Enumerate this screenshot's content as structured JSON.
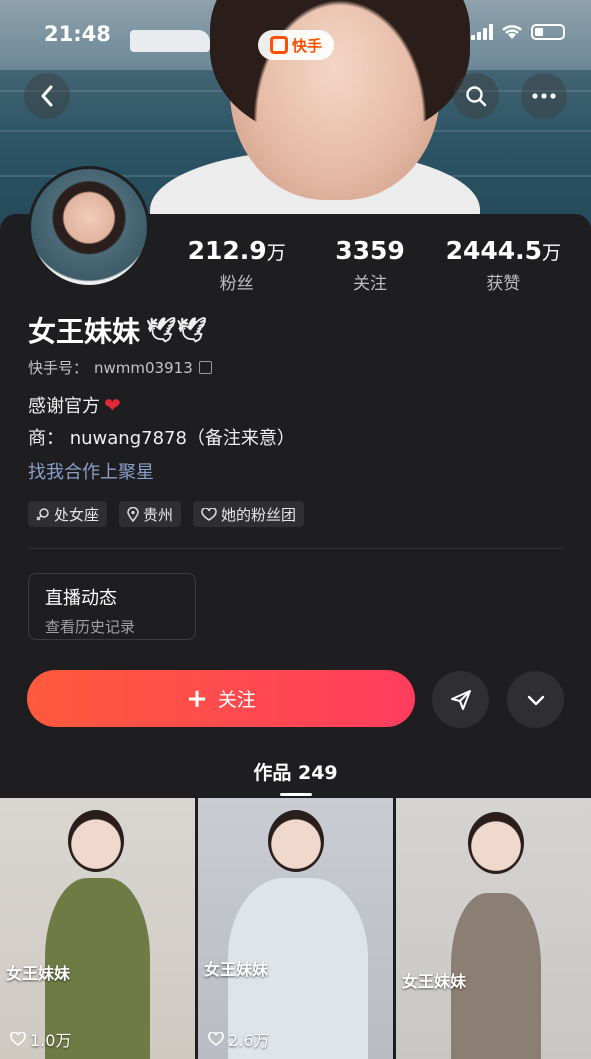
{
  "status_bar": {
    "time": "21:48",
    "app_badge": "快手"
  },
  "profile": {
    "name": "女王妹妹",
    "name_emoji": "🕊🕊",
    "kuaishou_id_label": "快手号：",
    "kuaishou_id": "nwmm03913",
    "bio_line1": "感谢官方",
    "bio_line1_emoji": "❤",
    "bio_line2": "商：  nuwang7878（备注来意）",
    "link": "找我合作上聚星"
  },
  "stats": [
    {
      "value": "212.9",
      "unit": "万",
      "label": "粉丝"
    },
    {
      "value": "3359",
      "unit": "",
      "label": "关注"
    },
    {
      "value": "2444.5",
      "unit": "万",
      "label": "获赞"
    }
  ],
  "tags": [
    {
      "icon": "zodiac-icon",
      "label": "处女座"
    },
    {
      "icon": "location-icon",
      "label": "贵州"
    },
    {
      "icon": "fan-group-icon",
      "label": "她的粉丝团"
    }
  ],
  "live_card": {
    "title": "直播动态",
    "subtitle": "查看历史记录"
  },
  "follow_button": {
    "label": "关注"
  },
  "works_tab": {
    "label": "作品 249"
  },
  "videos": [
    {
      "caption": "女王妹妹",
      "likes": "1.0万"
    },
    {
      "caption": "女王妹妹",
      "likes": "2.6万"
    },
    {
      "caption": "女王妹妹",
      "likes": ""
    }
  ],
  "colors": {
    "accent_start": "#ff5a3c",
    "accent_end": "#ff3d5e",
    "link": "#8b9dc9",
    "panel_bg": "#1e1e21"
  }
}
